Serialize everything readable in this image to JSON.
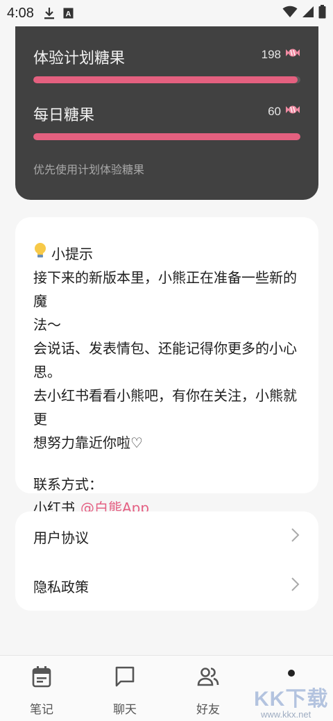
{
  "status_bar": {
    "time": "4:08",
    "icons": [
      "download-icon",
      "a-box-icon",
      "wifi-icon",
      "signal-icon",
      "battery-icon"
    ]
  },
  "candy": {
    "trial": {
      "label": "体验计划糖果",
      "count": "198",
      "fill_fraction": 0.99
    },
    "daily": {
      "label": "每日糖果",
      "count": "60",
      "fill_fraction": 1.0
    },
    "note": "优先使用计划体验糖果",
    "accent_color": "#e4607f"
  },
  "tips": {
    "title": "小提示",
    "lines": [
      "接下来的新版本里，小熊正在准备一些新的魔",
      "法～",
      "会说话、发表情包、还能记得你更多的小心",
      "思。",
      "去小红书看看小熊吧，有你在关注，小熊就更",
      "想努力靠近你啦♡"
    ],
    "contact_label": "联系方式：",
    "contact_platform": "小红书",
    "contact_handle": "@白熊App"
  },
  "links": {
    "user_agreement": "用户协议",
    "privacy_policy": "隐私政策"
  },
  "nav": {
    "notes": "笔记",
    "chat": "聊天",
    "friends": "好友"
  },
  "watermark": {
    "logo": "KK下载",
    "url": "www.kkx.net"
  }
}
